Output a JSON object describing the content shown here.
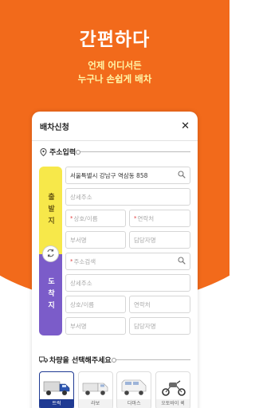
{
  "hero": {
    "headline": "간편하다",
    "sub_line1": "언제 어디서든",
    "sub_line2": "누구나 손쉽게 배차"
  },
  "card": {
    "title": "배차신청",
    "close_glyph": "✕"
  },
  "address_section": {
    "label": "주소입력"
  },
  "start": {
    "bar_label": "출발지",
    "address_value": "서울특별시 강남구 역삼동  858",
    "detail_placeholder": "상세주소",
    "name_placeholder": "상호/이름",
    "phone_placeholder": "연락처",
    "dept_placeholder": "부서명",
    "manager_placeholder": "담당자명"
  },
  "end": {
    "bar_label": "도착지",
    "address_placeholder": "주소검색",
    "detail_placeholder": "상세주소",
    "name_placeholder": "상호/이름",
    "phone_placeholder": "연락처",
    "dept_placeholder": "부서명",
    "manager_placeholder": "담당자명"
  },
  "vehicle_section": {
    "label": "차량을 선택해주세요"
  },
  "vehicles": [
    {
      "label": "트럭",
      "icon": "truck-icon",
      "selected": true
    },
    {
      "label": "라보",
      "icon": "labo-truck-icon",
      "selected": false
    },
    {
      "label": "다마스",
      "icon": "damas-van-icon",
      "selected": false
    },
    {
      "label": "오토바이 퀵",
      "icon": "motorcycle-icon",
      "selected": false
    }
  ],
  "colors": {
    "brand_orange": "#f26a1b",
    "start_yellow": "#f7e84a",
    "end_purple": "#7b5cc9",
    "selected_blue": "#1f3a93"
  }
}
